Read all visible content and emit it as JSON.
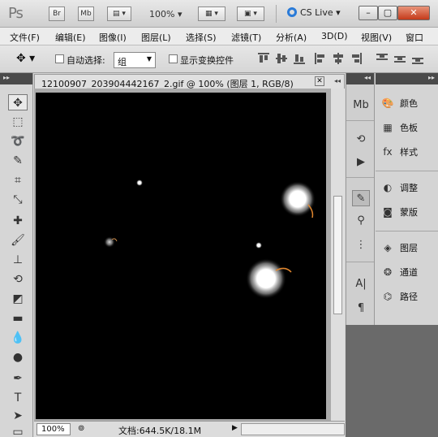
{
  "app": {
    "logo": "Ps"
  },
  "titlebar": {
    "bridge": "Br",
    "minibridge": "Mb",
    "zoom": "100%",
    "cslive": "CS Live",
    "min": "–",
    "max": "▢",
    "close": "✕"
  },
  "menu": [
    "文件(F)",
    "编辑(E)",
    "图像(I)",
    "图层(L)",
    "选择(S)",
    "滤镜(T)",
    "分析(A)",
    "3D(D)",
    "视图(V)",
    "窗口"
  ],
  "options": {
    "auto_select_label": "自动选择:",
    "auto_select_value": "组",
    "show_transform_label": "显示变换控件"
  },
  "document": {
    "tab_title": "12100907_203904442167_2.gif @ 100% (图层 1, RGB/8)",
    "zoom": "100%",
    "info": "文档:644.5K/18.1M"
  },
  "panels": {
    "group1": [
      "颜色",
      "色板",
      "样式"
    ],
    "group2": [
      "调整",
      "蒙版"
    ],
    "group3": [
      "图层",
      "通道",
      "路径"
    ]
  },
  "colors": {
    "canvas": "#000000",
    "accent": "#2a7bd8",
    "glow": "#ffffff",
    "streak": "#e0862e"
  }
}
